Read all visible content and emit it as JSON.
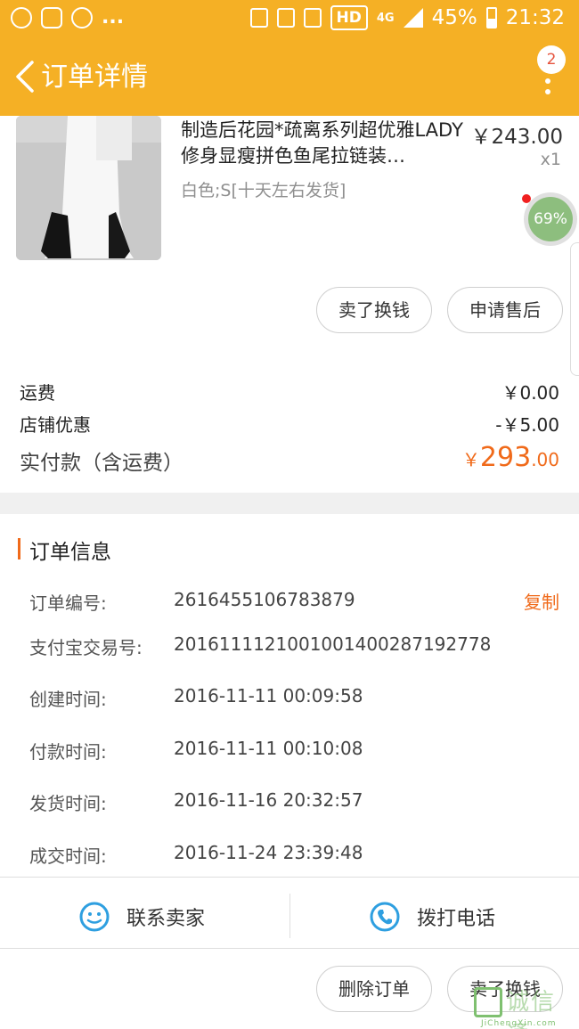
{
  "status_bar": {
    "notification_overflow": "...",
    "network": "HD",
    "network_type": "4G",
    "battery": "45%",
    "time": "21:32"
  },
  "header": {
    "title": "订单详情",
    "badge_count": "2",
    "accent_color": "#f5b025"
  },
  "product": {
    "title": "制造后花园*疏离系列超优雅LADY修身显瘦拼色鱼尾拉链装…",
    "sku": "白色;S[十天左右发货]",
    "price": "￥243.00",
    "quantity": "x1",
    "progress": "69%"
  },
  "product_actions": {
    "sell": "卖了换钱",
    "after_sale": "申请售后"
  },
  "fees": {
    "shipping_label": "运费",
    "shipping_value": "￥0.00",
    "discount_label": "店铺优惠",
    "discount_value": "-￥5.00",
    "total_label": "实付款（含运费）",
    "total_currency": "￥",
    "total_integer": "293",
    "total_decimal": ".00"
  },
  "order_info": {
    "title": "订单信息",
    "copy": "复制",
    "rows": [
      {
        "label": "订单编号:",
        "value": "2616455106783879"
      },
      {
        "label": "支付宝交易号:",
        "value": "2016111121001001400287192778"
      },
      {
        "label": "创建时间:",
        "value": "2016-11-11 00:09:58"
      },
      {
        "label": "付款时间:",
        "value": "2016-11-11 00:10:08"
      },
      {
        "label": "发货时间:",
        "value": "2016-11-16 20:32:57"
      },
      {
        "label": "成交时间:",
        "value": "2016-11-24 23:39:48"
      }
    ]
  },
  "contact": {
    "seller": "联系卖家",
    "call": "拨打电话"
  },
  "bottom_actions": {
    "delete": "删除订单",
    "sell": "卖了换钱"
  },
  "watermark": {
    "text": "诚信通",
    "site": "JiChengXin.com"
  }
}
